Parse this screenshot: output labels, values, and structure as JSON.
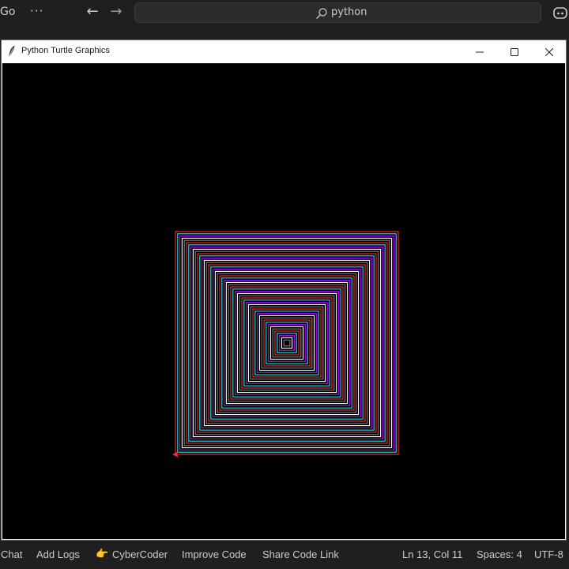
{
  "topbar": {
    "menu_go": "Go",
    "menu_more": "···",
    "search_text": "python",
    "icons": [
      "arrow-left-icon",
      "arrow-right-icon",
      "search-icon",
      "copilot-icon"
    ]
  },
  "window": {
    "title": "Python Turtle Graphics",
    "icons": [
      "feather-icon",
      "minimize-icon",
      "maximize-icon",
      "close-icon"
    ]
  },
  "canvas": {
    "background": "#000000",
    "pattern": "square spiral",
    "line_colors": [
      "#ff2a2a",
      "#20e0ff",
      "#b000ff",
      "#ffffff",
      "#7f7f7f"
    ]
  },
  "statusbar": {
    "chat": "Chat",
    "add_logs": "Add Logs",
    "hand_emoji": "👉",
    "cybercoder": "CyberCoder",
    "improve_code": "Improve Code",
    "share_code_link": "Share Code Link",
    "cursor_position": "Ln 13, Col 11",
    "spaces": "Spaces: 4",
    "encoding": "UTF-8"
  }
}
